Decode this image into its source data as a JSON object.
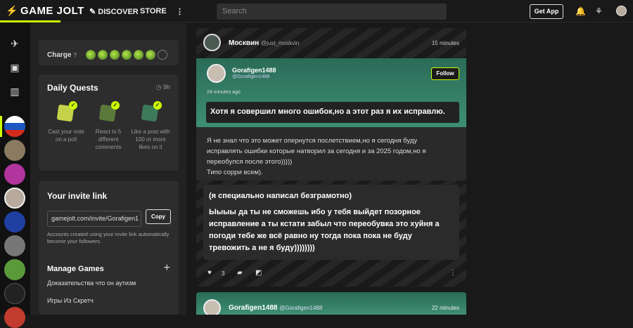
{
  "topbar": {
    "logo_text": "GAME JOLT",
    "discover_label": "DISCOVER",
    "store_label": "STORE",
    "more_label": "⋮",
    "search_placeholder": "Search",
    "get_app_label": "Get App",
    "accent_color": "#ccff00"
  },
  "sidebar": {
    "charge": {
      "label": "Charge",
      "filled": 6,
      "total": 7
    },
    "daily_quests": {
      "title": "Daily Quests",
      "timer": "9h",
      "quests": [
        {
          "label": "Cast your vote on a poll",
          "icon": "poll-quest-icon"
        },
        {
          "label": "React to 5 different comments",
          "icon": "comment-quest-icon"
        },
        {
          "label": "Like a post with 100 or more likes on it",
          "icon": "heart-quest-icon"
        }
      ]
    },
    "invite": {
      "title": "Your invite link",
      "link": "gamejolt.com/invite/Gorafigen1",
      "copy_label": "Copy",
      "note": "Accounts created using your invite link automatically become your followers."
    },
    "manage_games": {
      "title": "Manage Games",
      "plus": "+",
      "items": [
        "Доказательства что он аутизм",
        "Игры Из Скретч"
      ]
    }
  },
  "feed": {
    "post": {
      "author": "Москвин",
      "handle": "@just_moskvin",
      "time": "15 minutes",
      "repost": {
        "author": "Gorafigen1488",
        "handle": "@Gorafigen1488",
        "follow_label": "Follow",
        "time": "24 minutes ago",
        "text": "Хотя я совершил много ошибок,но а этот раз я их исправлю."
      },
      "body_lines": [
        "Я не знал что это может опернутся послетствием,но я сегодня буду",
        "исправлять ошибки которые натворил за сегодня и за 2025 годом,но я",
        "переобулся после этого)))))",
        "Типо сорри всем)."
      ],
      "quote_line1": "(я специально написал безграмотно)",
      "quote_line2": "Ыыыы да ты не сможешь ибо у тебя выйдет позорное исправление а ты кстати забыл что переобувка это хуйня а погоди тебе же всё равно ну тогда пока пока не буду тревожить а не я буду))))))))",
      "like_count": "3"
    },
    "next_post": {
      "author": "Gorafigen1488",
      "handle": "@Gorafigen1488",
      "time": "22 minutes"
    }
  }
}
